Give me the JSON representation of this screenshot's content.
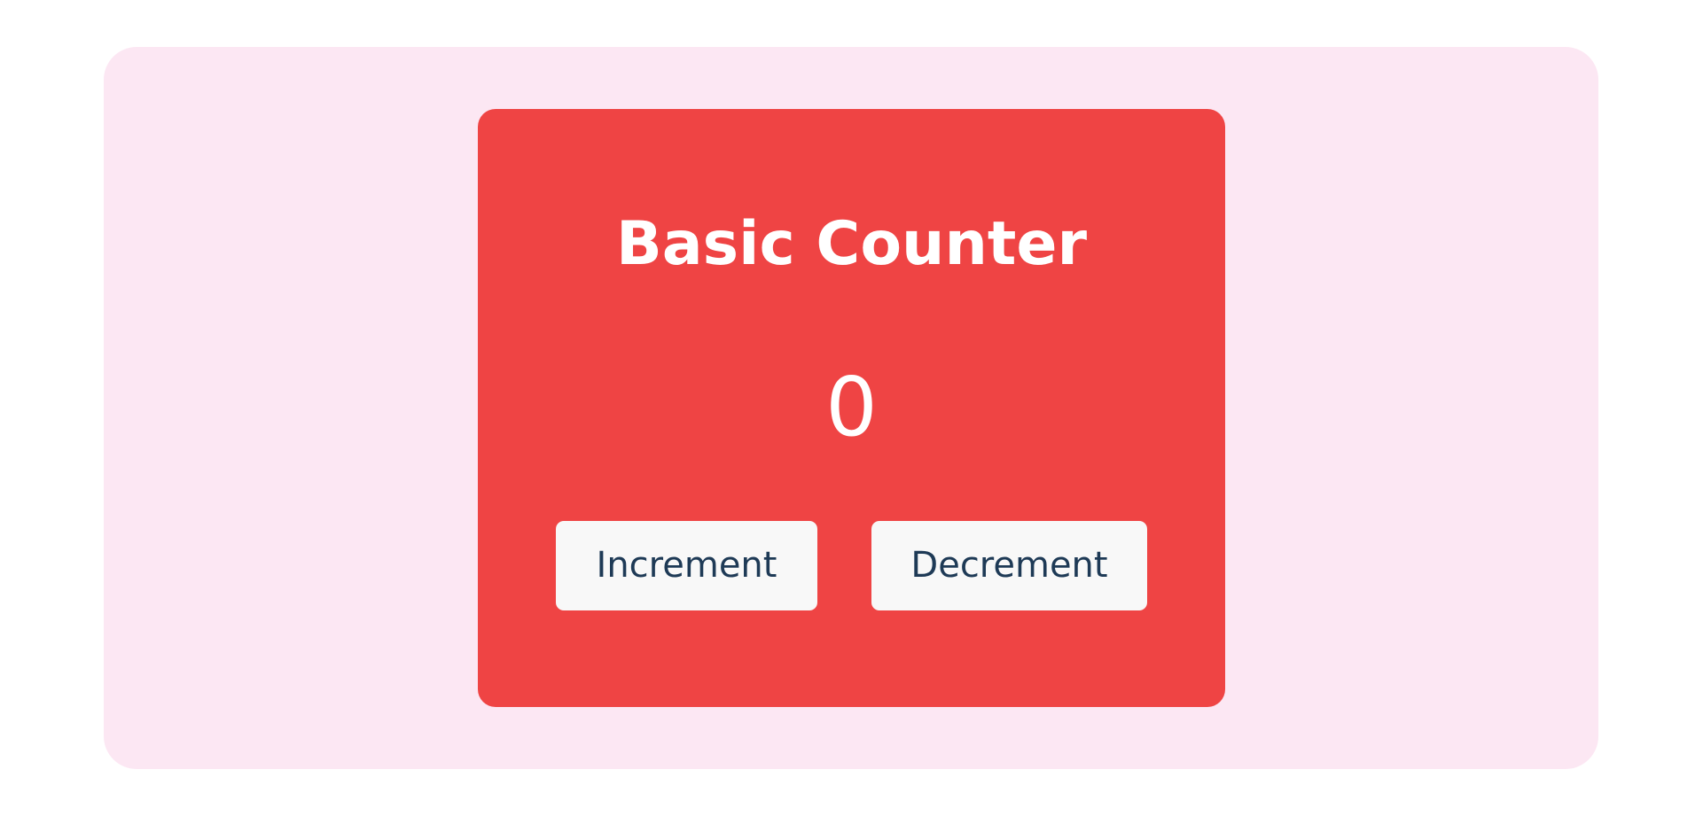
{
  "counter": {
    "title": "Basic Counter",
    "value": "0",
    "increment_label": "Increment",
    "decrement_label": "Decrement"
  },
  "colors": {
    "page_background": "#ffffff",
    "outer_panel": "#fce7f3",
    "card_background": "#ef4444",
    "card_text": "#ffffff",
    "button_background": "#f8f8f8",
    "button_text": "#1e3a56"
  }
}
